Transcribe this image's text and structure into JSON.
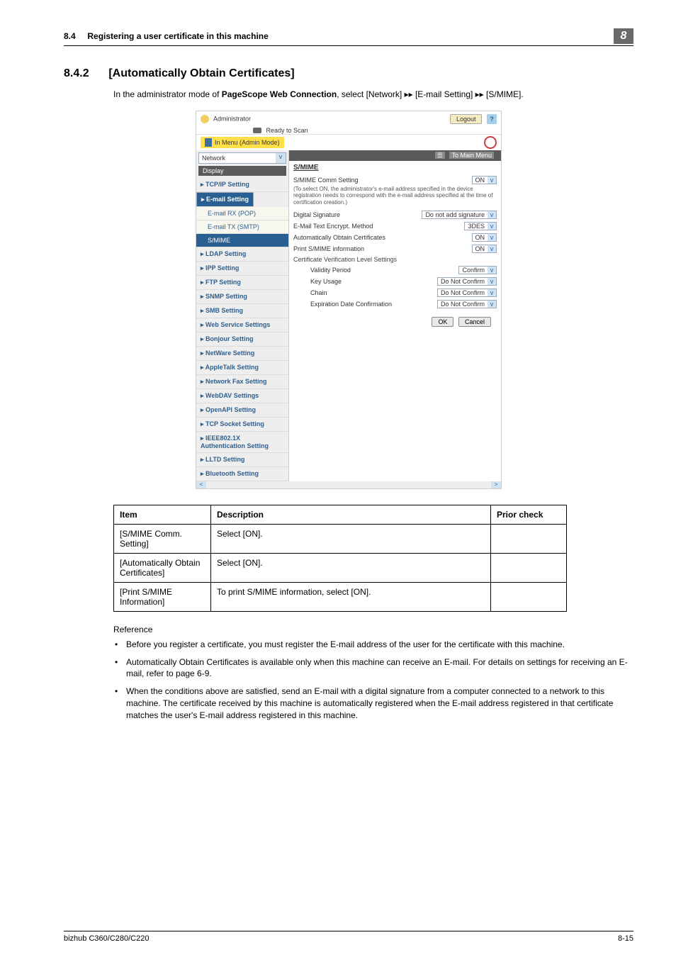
{
  "header": {
    "section": "8.4",
    "title": "Registering a user certificate in this machine",
    "chapter": "8"
  },
  "section": {
    "number": "8.4.2",
    "title": "[Automatically Obtain Certificates]",
    "intro_prefix": "In the administrator mode of ",
    "intro_bold": "PageScope Web Connection",
    "intro_suffix": ", select [Network] ▸▸ [E-mail Setting] ▸▸ [S/MIME]."
  },
  "shot": {
    "admin": "Administrator",
    "logout": "Logout",
    "help": "?",
    "ready": "Ready to Scan",
    "menu_mode": "In Menu (Admin Mode)",
    "network": "Network",
    "display": "Display",
    "to_main": "To Main Menu",
    "nav": [
      {
        "t": "TCP/IP Setting"
      },
      {
        "t": "E-mail Setting",
        "sel": true
      },
      {
        "t": "E-mail RX (POP)",
        "sub": true
      },
      {
        "t": "E-mail TX (SMTP)",
        "sub": true
      },
      {
        "t": "S/MIME",
        "sub": true,
        "selsub": true
      },
      {
        "t": "LDAP Setting"
      },
      {
        "t": "IPP Setting"
      },
      {
        "t": "FTP Setting"
      },
      {
        "t": "SNMP Setting"
      },
      {
        "t": "SMB Setting"
      },
      {
        "t": "Web Service Settings"
      },
      {
        "t": "Bonjour Setting"
      },
      {
        "t": "NetWare Setting"
      },
      {
        "t": "AppleTalk Setting"
      },
      {
        "t": "Network Fax Setting"
      },
      {
        "t": "WebDAV Settings"
      },
      {
        "t": "OpenAPI Setting"
      },
      {
        "t": "TCP Socket Setting"
      },
      {
        "t": "IEEE802.1X Authentication Setting"
      },
      {
        "t": "LLTD Setting"
      },
      {
        "t": "Bluetooth Setting"
      }
    ],
    "panel": {
      "heading": "S/MIME",
      "rows": [
        {
          "lbl": "S/MIME Comm Setting",
          "val": "ON"
        }
      ],
      "note": "(To select ON, the administrator's e-mail address specified in the device registration needs to correspond with the e-mail address specified at the time of certification creation.)",
      "rows2": [
        {
          "lbl": "Digital Signature",
          "val": "Do not add signature"
        },
        {
          "lbl": "E-Mail Text Encrypt. Method",
          "val": "3DES"
        },
        {
          "lbl": "Automatically Obtain Certificates",
          "val": "ON"
        },
        {
          "lbl": "Print S/MIME information",
          "val": "ON"
        }
      ],
      "cert_heading": "Certificate Verification Level Settings",
      "rows3": [
        {
          "lbl": "Validity Period",
          "val": "Confirm"
        },
        {
          "lbl": "Key Usage",
          "val": "Do Not Confirm"
        },
        {
          "lbl": "Chain",
          "val": "Do Not Confirm"
        },
        {
          "lbl": "Expiration Date Confirmation",
          "val": "Do Not Confirm"
        }
      ],
      "ok": "OK",
      "cancel": "Cancel"
    }
  },
  "table": {
    "headers": [
      "Item",
      "Description",
      "Prior check"
    ],
    "rows": [
      {
        "item": "[S/MIME Comm. Setting]",
        "desc": "Select [ON].",
        "prior": ""
      },
      {
        "item": "[Automatically Obtain Certificates]",
        "desc": "Select [ON].",
        "prior": ""
      },
      {
        "item": "[Print S/MIME Information]",
        "desc": "To print S/MIME information, select [ON].",
        "prior": ""
      }
    ]
  },
  "reference": {
    "label": "Reference",
    "bullets": [
      "Before you register a certificate, you must register the E-mail address of the user for the certificate with this machine.",
      "Automatically Obtain Certificates is available only when this machine can receive an E-mail. For details on settings for receiving an E-mail, refer to page 6-9.",
      "When the conditions above are satisfied, send an E-mail with a digital signature from a computer connected to a network to this machine. The certificate received by this machine is automatically registered when the E-mail address registered in that certificate matches the user's E-mail address registered in this machine."
    ]
  },
  "footer": {
    "left": "bizhub C360/C280/C220",
    "right": "8-15"
  }
}
